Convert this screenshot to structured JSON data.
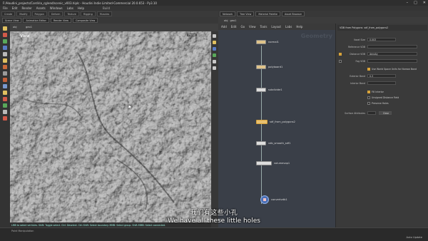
{
  "window": {
    "title": "F:/Houdini_projects/Cordiria_cg/end/scenic_v003.hiplc - Houdini Indie Limited-Commercial 20.0.653 - Py3.10",
    "controls": [
      "–",
      "□",
      "✕"
    ]
  },
  "menu": [
    "File",
    "Edit",
    "Render",
    "Assets",
    "Windows",
    "Labs",
    "Help"
  ],
  "desktop": {
    "name": "Build"
  },
  "shelf_tabs": [
    "Create",
    "Modify",
    "Polygon",
    "Deform",
    "Texture",
    "Rigging",
    "Muscles",
    "Characters",
    "Constraints",
    "Hair Utils",
    "Guide Process",
    "Terrain FX",
    "Simple FX",
    "Volume"
  ],
  "viewport": {
    "tabs": [
      "Scene View",
      "Animation Editor",
      "Render View",
      "Composite View",
      "Motion FX View",
      "Geometry Spreadsheet"
    ],
    "path": "obj",
    "node": "geo1",
    "label": "View",
    "camera": "Persp",
    "status": "LMB to select verticies. Shift: Toggle select. Ctrl: Deselect. Ctrl-Shift: Select boundary. MMB: Select group. Shift-MMB: Select connected."
  },
  "network": {
    "tabs": [
      "Network",
      "Tree View",
      "Material Palette",
      "Asset Browser"
    ],
    "path": "obj",
    "node": "geo1",
    "menu": [
      "Add",
      "Edit",
      "Go",
      "View",
      "Tools",
      "Layout",
      "Labs",
      "Help"
    ],
    "context": "Geometry",
    "nodes": [
      {
        "name": "normal1",
        "color": "#e0c48a"
      },
      {
        "name": "polyboard1",
        "color": "#e0c48a"
      },
      {
        "name": "subdivide1",
        "color": "#d6d6d6"
      },
      {
        "name": "sdf_from_polygons2",
        "color": "#e8c070"
      },
      {
        "name": "vdb_smooth_sdf1",
        "color": "#d6d6d6"
      },
      {
        "name": "volumevop1",
        "color": "#d6d6d6"
      },
      {
        "name": "convertvdb1",
        "color": "#4a6fb5"
      }
    ]
  },
  "params": {
    "node_type": "VDB from Polygons",
    "node_name": "sdf_from_polygons2",
    "fields": [
      {
        "label": "Voxel Size",
        "value": "0.003"
      },
      {
        "label": "Reference VDB",
        "value": ""
      },
      {
        "label": "Distance VDB",
        "value": "density"
      },
      {
        "label": "Fog VDB",
        "value": ""
      },
      {
        "label": "Exterior Band",
        "value": "0.3"
      },
      {
        "label": "Interior Band",
        "value": ""
      },
      {
        "label": "Surface Attributes",
        "value": ""
      }
    ],
    "checkboxes": [
      {
        "label": "Use World Space Units for Narrow Band",
        "on": true
      },
      {
        "label": "Fill Interior",
        "on": true
      },
      {
        "label": "Unsigned Distance Field",
        "on": false
      },
      {
        "label": "Preserve Holes",
        "on": false
      }
    ],
    "clear_label": "Clear"
  },
  "subtitles": {
    "cn": "我们有这些小孔",
    "en": "We have all these little holes"
  },
  "watermark": "www.cgtu.com",
  "bottombar": {
    "message": "Paint Manipulation",
    "mode": "Auto Update"
  },
  "colors": {
    "accent": "#d8a33a",
    "viewport_bg": "#8b8b8b",
    "network_bg": "#3a3f48"
  }
}
